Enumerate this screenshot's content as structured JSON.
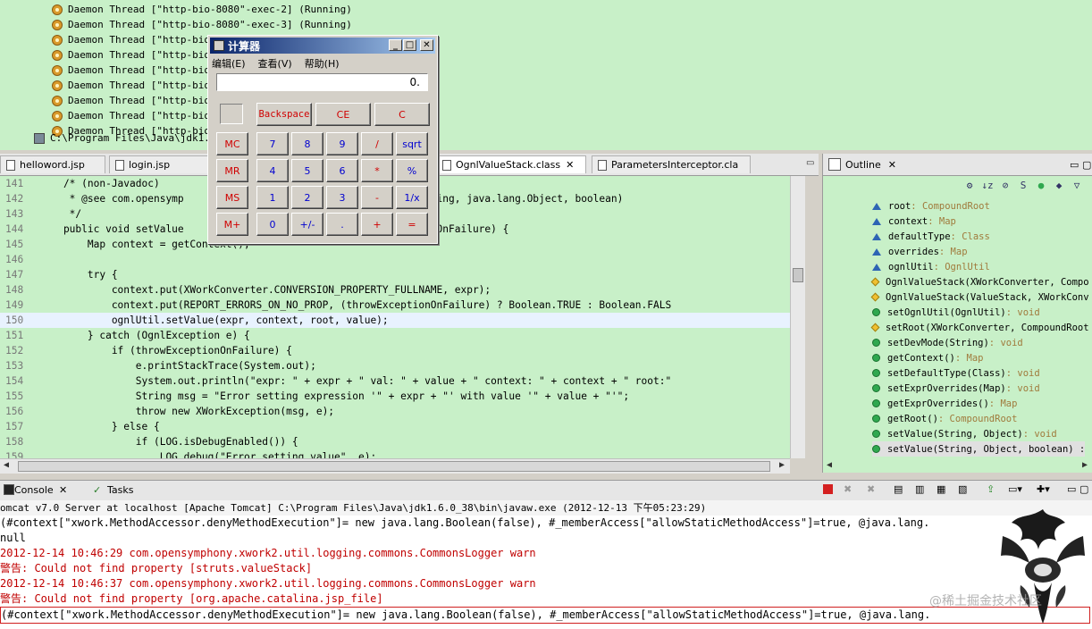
{
  "debug": {
    "threads": [
      "Daemon Thread [\"http-bio-8080\"-exec-2] (Running)",
      "Daemon Thread [\"http-bio-8080\"-exec-3] (Running)",
      "Daemon Thread [\"http-bio-8080\"-exec-4] (Running)",
      "Daemon Thread [\"http-bio-8",
      "Daemon Thread [\"http-bio-8",
      "Daemon Thread [\"http-bio-8",
      "Daemon Thread [\"http-bio-8",
      "Daemon Thread [\"http-bio-8",
      "Daemon Thread [\"http-bio-8"
    ],
    "jdk_path": "C:\\Program Files\\Java\\jdk1.6."
  },
  "editor": {
    "tabs": [
      {
        "label": "helloword.jsp",
        "active": false
      },
      {
        "label": "login.jsp",
        "active": false
      },
      {
        "label": "OgnlValueStack.class",
        "active": true
      },
      {
        "label": "ParametersInterceptor.cla",
        "active": false
      }
    ],
    "lines": [
      {
        "num": "141",
        "code": "    /* (non-Javadoc)"
      },
      {
        "num": "142",
        "code": "     * @see com.opensymp                       Value(java.lang.String, java.lang.Object, boolean)"
      },
      {
        "num": "143",
        "code": "     */"
      },
      {
        "num": "144",
        "code": "    public void setValue                        ean throwExceptionOnFailure) {"
      },
      {
        "num": "145",
        "code": "        Map context = getContext();"
      },
      {
        "num": "146",
        "code": ""
      },
      {
        "num": "147",
        "code": "        try {"
      },
      {
        "num": "148",
        "code": "            context.put(XWorkConverter.CONVERSION_PROPERTY_FULLNAME, expr);"
      },
      {
        "num": "149",
        "code": "            context.put(REPORT_ERRORS_ON_NO_PROP, (throwExceptionOnFailure) ? Boolean.TRUE : Boolean.FALS"
      },
      {
        "num": "150",
        "code": "            ognlUtil.setValue(expr, context, root, value);"
      },
      {
        "num": "151",
        "code": "        } catch (OgnlException e) {"
      },
      {
        "num": "152",
        "code": "            if (throwExceptionOnFailure) {"
      },
      {
        "num": "153",
        "code": "                e.printStackTrace(System.out);"
      },
      {
        "num": "154",
        "code": "                System.out.println(\"expr: \" + expr + \" val: \" + value + \" context: \" + context + \" root:\""
      },
      {
        "num": "155",
        "code": "                String msg = \"Error setting expression '\" + expr + \"' with value '\" + value + \"'\";"
      },
      {
        "num": "156",
        "code": "                throw new XWorkException(msg, e);"
      },
      {
        "num": "157",
        "code": "            } else {"
      },
      {
        "num": "158",
        "code": "                if (LOG.isDebugEnabled()) {"
      },
      {
        "num": "159",
        "code": "                    LOG.debug(\"Error setting value\", e);"
      }
    ]
  },
  "outline": {
    "tab_label": "Outline",
    "items": [
      {
        "name": "root",
        "type": " : CompoundRoot",
        "icon": "tri"
      },
      {
        "name": "context",
        "type": " : Map",
        "icon": "tri"
      },
      {
        "name": "defaultType",
        "type": " : Class",
        "icon": "tri"
      },
      {
        "name": "overrides",
        "type": " : Map",
        "icon": "tri"
      },
      {
        "name": "ognlUtil",
        "type": " : OgnlUtil",
        "icon": "tri"
      },
      {
        "name": "OgnlValueStack(XWorkConverter, Compo",
        "type": "",
        "icon": "dia"
      },
      {
        "name": "OgnlValueStack(ValueStack, XWorkConv",
        "type": "",
        "icon": "dia"
      },
      {
        "name": "setOgnlUtil(OgnlUtil)",
        "type": " : void",
        "icon": "dot"
      },
      {
        "name": "setRoot(XWorkConverter, CompoundRoot",
        "type": "",
        "icon": "dia"
      },
      {
        "name": "setDevMode(String)",
        "type": " : void",
        "icon": "dot"
      },
      {
        "name": "getContext()",
        "type": " : Map",
        "icon": "dot"
      },
      {
        "name": "setDefaultType(Class)",
        "type": " : void",
        "icon": "dot"
      },
      {
        "name": "setExprOverrides(Map)",
        "type": " : void",
        "icon": "dot"
      },
      {
        "name": "getExprOverrides()",
        "type": " : Map",
        "icon": "dot"
      },
      {
        "name": "getRoot()",
        "type": " : CompoundRoot",
        "icon": "dot"
      },
      {
        "name": "setValue(String, Object)",
        "type": " : void",
        "icon": "dot"
      },
      {
        "name": "setValue(String, Object, boolean) :",
        "type": "",
        "icon": "dot"
      }
    ]
  },
  "console": {
    "tabs": [
      "Console",
      "Tasks"
    ],
    "status": "omcat v7.0 Server at localhost [Apache Tomcat] C:\\Program Files\\Java\\jdk1.6.0_38\\bin\\javaw.exe (2012-12-13 下午05:23:29)",
    "lines": [
      {
        "text": "(#context[\"xwork.MethodAccessor.denyMethodExecution\"]= new java.lang.Boolean(false), #_memberAccess[\"allowStaticMethodAccess\"]=true, @java.lang.",
        "style": "black"
      },
      {
        "text": "null",
        "style": "black"
      },
      {
        "text": "2012-12-14 10:46:29 com.opensymphony.xwork2.util.logging.commons.CommonsLogger warn",
        "style": "red"
      },
      {
        "text": "警告: Could not find property [struts.valueStack]",
        "style": "red"
      },
      {
        "text": "2012-12-14 10:46:37 com.opensymphony.xwork2.util.logging.commons.CommonsLogger warn",
        "style": "red"
      },
      {
        "text": "警告: Could not find property [org.apache.catalina.jsp_file]",
        "style": "red"
      },
      {
        "text": "(#context[\"xwork.MethodAccessor.denyMethodExecution\"]= new java.lang.Boolean(false), #_memberAccess[\"allowStaticMethodAccess\"]=true, @java.lang.",
        "style": "boxed"
      }
    ],
    "watermark": "@稀土掘金技术社区"
  },
  "calculator": {
    "title": "计算器",
    "menu": [
      "编辑(E)",
      "查看(V)",
      "帮助(H)"
    ],
    "display": "0.",
    "top_buttons": [
      "Backspace",
      "CE",
      "C"
    ],
    "memory_buttons": [
      "MC",
      "MR",
      "MS",
      "M+"
    ],
    "rows": [
      [
        "7",
        "8",
        "9",
        "/",
        "sqrt"
      ],
      [
        "4",
        "5",
        "6",
        "*",
        "%"
      ],
      [
        "1",
        "2",
        "3",
        "-",
        "1/x"
      ],
      [
        "0",
        "+/-",
        ".",
        "+",
        "="
      ]
    ]
  }
}
